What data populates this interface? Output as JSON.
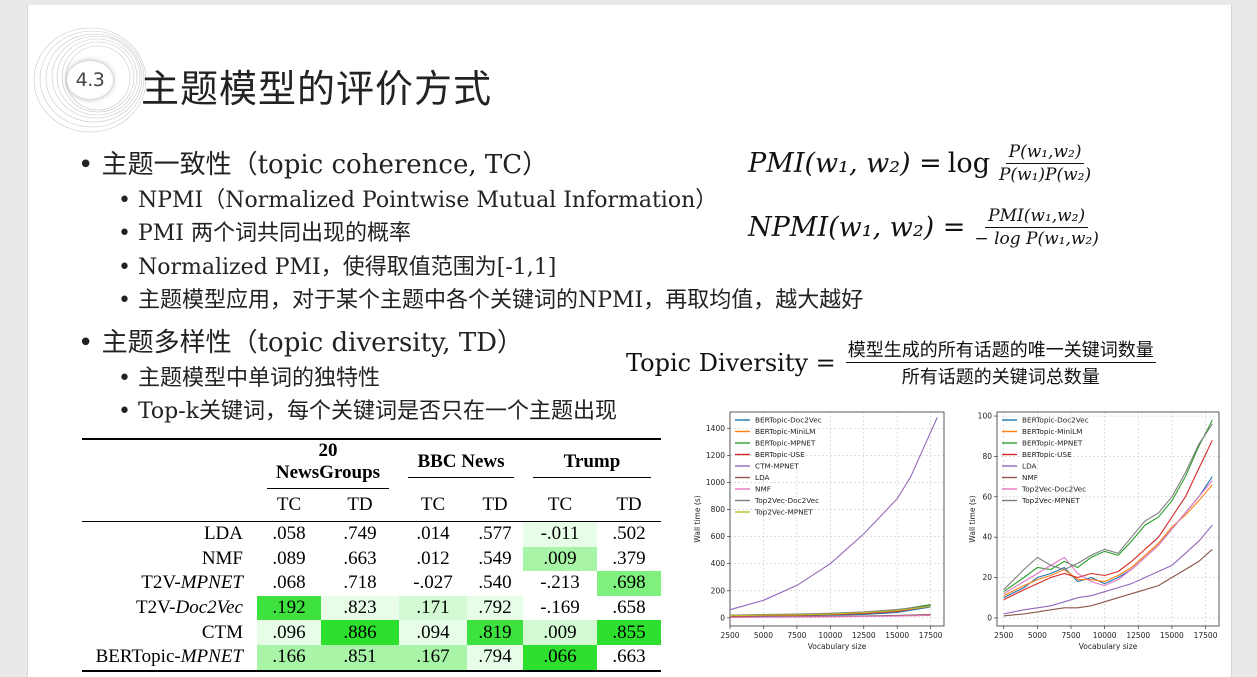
{
  "header": {
    "section_number": "4.3",
    "title": "主题模型的评价方式"
  },
  "bullets": {
    "tc_heading": "• 主题一致性（topic coherence, TC）",
    "tc_items": [
      "• NPMI（Normalized Pointwise Mutual Information）",
      "• PMI 两个词共同出现的概率",
      "• Normalized PMI，使得取值范围为[-1,1]",
      "• 主题模型应用，对于某个主题中各个关键词的NPMI，再取均值，越大越好"
    ],
    "td_heading": "• 主题多样性（topic diversity, TD）",
    "td_items": [
      "• 主题模型中单词的独特性",
      "• Top-k关键词，每个关键词是否只在一个主题出现"
    ]
  },
  "formulas": {
    "pmi_lhs": "PMI(w₁, w₂) = ",
    "pmi_log": "log",
    "pmi_num": "P(w₁,w₂)",
    "pmi_den": "P(w₁)P(w₂)",
    "npmi_lhs": "NPMI(w₁, w₂) = ",
    "npmi_num": "PMI(w₁,w₂)",
    "npmi_den": "− log P(w₁,w₂)",
    "td_lhs": "Topic Diversity =",
    "td_num": "模型生成的所有话题的唯一关键词数量",
    "td_den": "所有话题的关键词总数量"
  },
  "table": {
    "groups": [
      "20 NewsGroups",
      "BBC News",
      "Trump"
    ],
    "subheaders": [
      "TC",
      "TD",
      "TC",
      "TD",
      "TC",
      "TD"
    ],
    "rows": [
      {
        "label": "LDA",
        "label_italic": "",
        "cells": [
          ".058",
          ".749",
          ".014",
          ".577",
          "-.011",
          ".502"
        ]
      },
      {
        "label": "NMF",
        "label_italic": "",
        "cells": [
          ".089",
          ".663",
          ".012",
          ".549",
          ".009",
          ".379"
        ]
      },
      {
        "label": "T2V-",
        "label_italic": "MPNET",
        "cells": [
          ".068",
          ".718",
          "-.027",
          ".540",
          "-.213",
          ".698"
        ]
      },
      {
        "label": "T2V-",
        "label_italic": "Doc2Vec",
        "cells": [
          ".192",
          ".823",
          ".171",
          ".792",
          "-.169",
          ".658"
        ]
      },
      {
        "label": "CTM",
        "label_italic": "",
        "cells": [
          ".096",
          ".886",
          ".094",
          ".819",
          ".009",
          ".855"
        ]
      },
      {
        "label": "BERTopic-",
        "label_italic": "MPNET",
        "cells": [
          ".166",
          ".851",
          ".167",
          ".794",
          ".066",
          ".663"
        ]
      }
    ],
    "highlights": [
      [
        "",
        "",
        "",
        "",
        "#e8fde8",
        ""
      ],
      [
        "",
        "",
        "",
        "",
        "#a8f5a8",
        ""
      ],
      [
        "",
        "",
        "",
        "",
        "",
        "#7ef07e"
      ],
      [
        "#3ee23e",
        "#e8fde8",
        "#d4fad4",
        "#e8fde8",
        "",
        ""
      ],
      [
        "#e8fde8",
        "#2ee02e",
        "#e8fde8",
        "#3ee23e",
        "#d4fad4",
        "#2ee02e"
      ],
      [
        "#a8f5a8",
        "#a8f5a8",
        "#a8f5a8",
        "#e8fde8",
        "#2ee02e",
        ""
      ]
    ]
  },
  "chart_data": [
    {
      "type": "line",
      "xlabel": "Vocabulary size",
      "ylabel": "Wall time (s)",
      "xlim": [
        2500,
        18500
      ],
      "ylim": [
        -60,
        1520
      ],
      "xticks": [
        2500,
        5000,
        7500,
        10000,
        12500,
        15000,
        17500
      ],
      "yticks": [
        0,
        200,
        400,
        600,
        800,
        1000,
        1200,
        1400
      ],
      "legend_placement": "top-left",
      "series": [
        {
          "name": "BERTopic-Doc2Vec",
          "color": "#1f77b4",
          "x": [
            2500,
            5000,
            7500,
            10000,
            12500,
            15000,
            17500
          ],
          "y": [
            12,
            14,
            16,
            20,
            26,
            40,
            80
          ]
        },
        {
          "name": "BERTopic-MiniLM",
          "color": "#ff7f0e",
          "x": [
            2500,
            5000,
            7500,
            10000,
            12500,
            15000,
            17500
          ],
          "y": [
            15,
            18,
            20,
            26,
            34,
            52,
            92
          ]
        },
        {
          "name": "BERTopic-MPNET",
          "color": "#2ca02c",
          "x": [
            2500,
            5000,
            7500,
            10000,
            12500,
            15000,
            17500
          ],
          "y": [
            18,
            22,
            24,
            30,
            40,
            58,
            98
          ]
        },
        {
          "name": "BERTopic-USE",
          "color": "#d62728",
          "x": [
            2500,
            5000,
            7500,
            10000,
            12500,
            15000,
            17500
          ],
          "y": [
            14,
            17,
            19,
            24,
            32,
            48,
            86
          ]
        },
        {
          "name": "CTM-MPNET",
          "color": "#9467bd",
          "x": [
            2500,
            5000,
            7500,
            10000,
            12500,
            15000,
            16000,
            17000,
            18000
          ],
          "y": [
            60,
            130,
            240,
            400,
            620,
            880,
            1040,
            1260,
            1480
          ]
        },
        {
          "name": "LDA",
          "color": "#8c564b",
          "x": [
            2500,
            5000,
            7500,
            10000,
            12500,
            15000,
            17500
          ],
          "y": [
            5,
            7,
            9,
            11,
            14,
            18,
            24
          ]
        },
        {
          "name": "NMF",
          "color": "#e377c2",
          "x": [
            2500,
            5000,
            7500,
            10000,
            12500,
            15000,
            17500
          ],
          "y": [
            3,
            5,
            6,
            8,
            10,
            13,
            18
          ]
        },
        {
          "name": "Top2Vec-Doc2Vec",
          "color": "#7f7f7f",
          "x": [
            2500,
            5000,
            7500,
            10000,
            12500,
            15000,
            17500
          ],
          "y": [
            20,
            24,
            28,
            34,
            44,
            62,
            90
          ]
        },
        {
          "name": "Top2Vec-MPNET",
          "color": "#bcbd22",
          "x": [
            2500,
            5000,
            7500,
            10000,
            12500,
            15000,
            17500
          ],
          "y": [
            16,
            20,
            22,
            28,
            38,
            54,
            84
          ]
        }
      ]
    },
    {
      "type": "line",
      "xlabel": "Vocabulary size",
      "ylabel": "Wall time (s)",
      "xlim": [
        2000,
        18500
      ],
      "ylim": [
        -4,
        102
      ],
      "xticks": [
        2500,
        5000,
        7500,
        10000,
        12500,
        15000,
        17500
      ],
      "yticks": [
        0,
        20,
        40,
        60,
        80,
        100
      ],
      "legend_placement": "top-left",
      "series": [
        {
          "name": "BERTopic-Doc2Vec",
          "color": "#1f77b4",
          "x": [
            2500,
            4000,
            5000,
            6000,
            7000,
            8000,
            9000,
            10000,
            11000,
            12000,
            13000,
            14000,
            15000,
            16000,
            17000,
            18000
          ],
          "y": [
            10,
            15,
            20,
            22,
            25,
            18,
            20,
            17,
            20,
            24,
            30,
            36,
            44,
            52,
            60,
            70
          ]
        },
        {
          "name": "BERTopic-MiniLM",
          "color": "#ff7f0e",
          "x": [
            2500,
            4000,
            5000,
            6000,
            7000,
            8000,
            9000,
            10000,
            11000,
            12000,
            13000,
            14000,
            15000,
            16000,
            17000,
            18000
          ],
          "y": [
            11,
            16,
            19,
            21,
            24,
            19,
            19,
            18,
            21,
            25,
            31,
            37,
            45,
            51,
            58,
            66
          ]
        },
        {
          "name": "BERTopic-MPNET",
          "color": "#2ca02c",
          "x": [
            2500,
            4000,
            5000,
            6000,
            7000,
            8000,
            9000,
            10000,
            11000,
            12000,
            13000,
            14000,
            15000,
            16000,
            17000,
            18000
          ],
          "y": [
            13,
            20,
            25,
            24,
            28,
            25,
            30,
            33,
            31,
            38,
            46,
            50,
            58,
            70,
            85,
            98
          ]
        },
        {
          "name": "BERTopic-USE",
          "color": "#d62728",
          "x": [
            2500,
            4000,
            5000,
            6000,
            7000,
            8000,
            9000,
            10000,
            11000,
            12000,
            13000,
            14000,
            15000,
            16000,
            17000,
            18000
          ],
          "y": [
            9,
            14,
            17,
            20,
            22,
            20,
            22,
            21,
            23,
            28,
            34,
            40,
            50,
            60,
            74,
            88
          ]
        },
        {
          "name": "LDA",
          "color": "#9467bd",
          "x": [
            2500,
            4000,
            5000,
            6000,
            7000,
            8000,
            9000,
            10000,
            11000,
            12000,
            13000,
            14000,
            15000,
            16000,
            17000,
            18000
          ],
          "y": [
            2,
            4,
            5,
            6,
            8,
            10,
            11,
            13,
            15,
            17,
            20,
            23,
            26,
            32,
            38,
            46
          ]
        },
        {
          "name": "NMF",
          "color": "#8c564b",
          "x": [
            2500,
            4000,
            5000,
            6000,
            7000,
            8000,
            9000,
            10000,
            11000,
            12000,
            13000,
            14000,
            15000,
            16000,
            17000,
            18000
          ],
          "y": [
            1,
            2,
            3,
            4,
            5,
            5,
            6,
            8,
            10,
            12,
            14,
            16,
            20,
            24,
            28,
            34
          ]
        },
        {
          "name": "Top2Vec-Doc2Vec",
          "color": "#e377c2",
          "x": [
            2500,
            4000,
            5000,
            6000,
            7000,
            8000,
            9000,
            10000,
            11000,
            12000,
            13000,
            14000,
            15000,
            16000,
            17000,
            18000
          ],
          "y": [
            12,
            18,
            22,
            26,
            30,
            22,
            18,
            16,
            19,
            24,
            30,
            36,
            44,
            52,
            60,
            68
          ]
        },
        {
          "name": "Top2Vec-MPNET",
          "color": "#7f7f7f",
          "x": [
            2500,
            4000,
            5000,
            6000,
            7000,
            8000,
            9000,
            10000,
            11000,
            12000,
            13000,
            14000,
            15000,
            16000,
            17000,
            18000
          ],
          "y": [
            14,
            24,
            30,
            26,
            24,
            27,
            31,
            34,
            32,
            40,
            48,
            52,
            60,
            72,
            86,
            96
          ]
        }
      ]
    }
  ]
}
